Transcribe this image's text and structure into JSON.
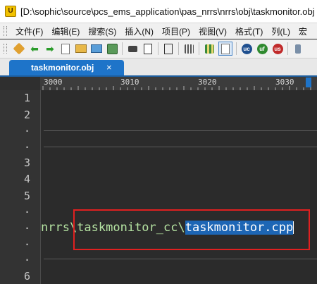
{
  "window": {
    "title": "[D:\\sophic\\source\\pcs_ems_application\\pas_nrrs\\nrrs\\obj\\taskmonitor.obj"
  },
  "menu": {
    "items": [
      "文件(F)",
      "编辑(E)",
      "搜索(S)",
      "插入(N)",
      "项目(P)",
      "视图(V)",
      "格式(T)",
      "列(L)",
      "宏"
    ]
  },
  "toolbar": {
    "icons": [
      "pencil-icon",
      "back-arrow-icon",
      "forward-arrow-icon",
      "new-file-icon",
      "open-folder-icon",
      "open-project-icon",
      "save-icon",
      "print-icon",
      "print-preview-icon",
      "spellcheck-icon",
      "cut-icon",
      "columns-icon",
      "word-wrap-icon",
      "uc-icon",
      "uf-icon",
      "us-icon",
      "scissors-icon"
    ]
  },
  "tab": {
    "label": "taskmonitor.obj",
    "close": "×"
  },
  "ruler": {
    "labels": [
      "3000",
      "3010",
      "3020",
      "3030"
    ]
  },
  "gutter": {
    "lines": [
      "1",
      "2",
      "·",
      "·",
      "3",
      "4",
      "5",
      "·",
      "·",
      "·",
      "·",
      "6"
    ]
  },
  "editor": {
    "segments": {
      "part1": "nrrs\\",
      "part2": "taskmonitor_cc\\",
      "part3": "taskmonitor.cpp"
    }
  },
  "colors": {
    "tab_accent": "#1e74c9",
    "selection": "#1d66b5",
    "highlight_box": "#e02020",
    "editor_bg": "#2b2b2b"
  }
}
